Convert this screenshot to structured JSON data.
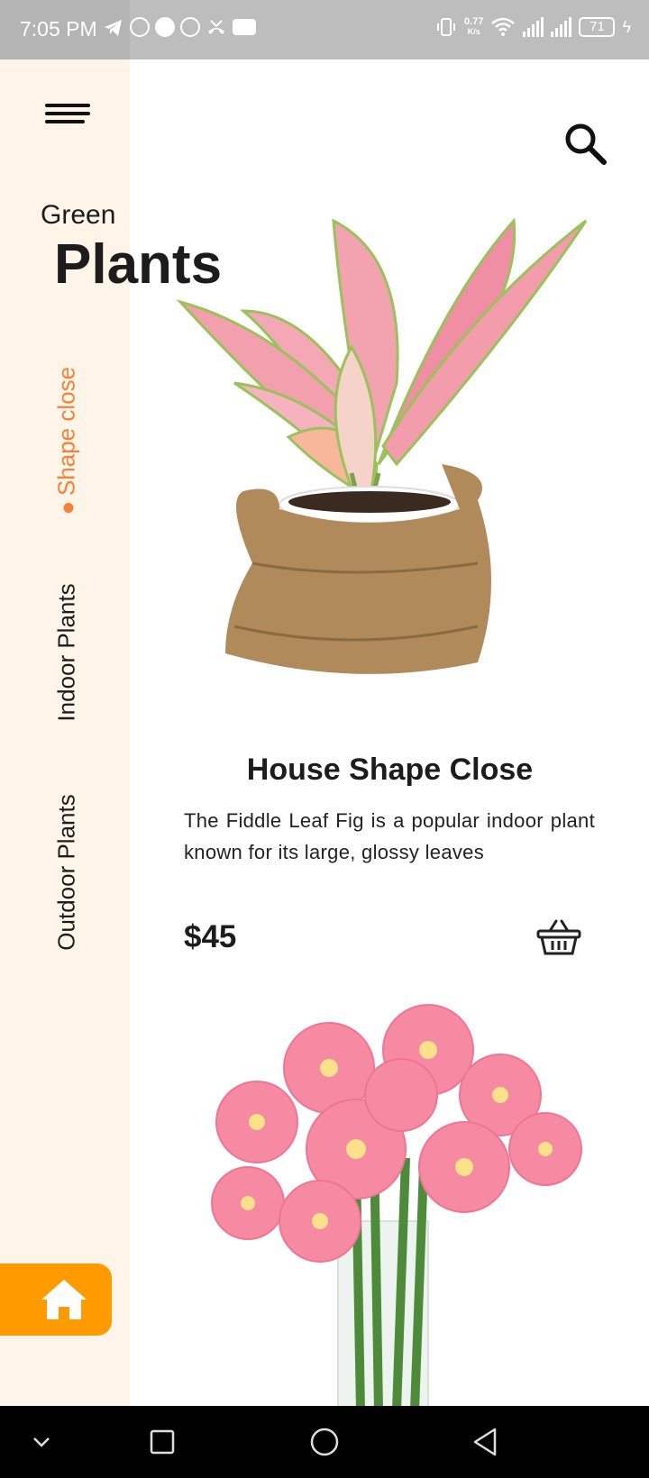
{
  "status_bar": {
    "time": "7:05 PM",
    "speed": "0.77",
    "speed_unit": "K/s",
    "battery": "71",
    "icons": [
      "telegram-icon",
      "whatsapp-icon",
      "pinterest-icon",
      "whatsapp-icon",
      "missed-call-icon",
      "youtube-icon",
      "vibrate-icon",
      "wifi-icon",
      "signal-icon",
      "signal-icon",
      "battery-icon",
      "charging-icon"
    ]
  },
  "header": {
    "title_small": "Green",
    "title_big": "Plants"
  },
  "sidebar": {
    "items": [
      {
        "label": "Shape close",
        "active": true
      },
      {
        "label": "Indoor Plants",
        "active": false
      },
      {
        "label": "Outdoor Plants",
        "active": false
      }
    ],
    "accent_color": "#f7803a",
    "background": "#fef4e8",
    "home_button_color": "#ff9b00"
  },
  "product": {
    "name": "House Shape Close",
    "description": "The Fiddle Leaf Fig is a popular indoor plant known for its large, glossy leaves",
    "price": "$45"
  },
  "icons": {
    "menu": "menu-icon",
    "search": "search-icon",
    "basket": "basket-icon",
    "home": "home-icon"
  }
}
